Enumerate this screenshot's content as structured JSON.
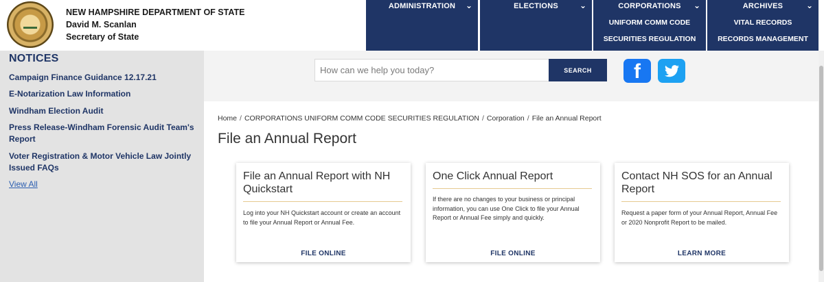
{
  "header": {
    "agency": "NEW HAMPSHIRE DEPARTMENT OF STATE",
    "official": "David M. Scanlan",
    "title": "Secretary of State"
  },
  "nav": [
    {
      "label": "ADMINISTRATION",
      "sub": []
    },
    {
      "label": "ELECTIONS",
      "sub": []
    },
    {
      "label": "CORPORATIONS",
      "sub": [
        "UNIFORM COMM CODE",
        "SECURITIES REGULATION"
      ]
    },
    {
      "label": "ARCHIVES",
      "sub": [
        "VITAL RECORDS",
        "RECORDS MANAGEMENT"
      ]
    }
  ],
  "sidebar": {
    "title": "NOTICES",
    "items": [
      "Campaign Finance Guidance 12.17.21",
      "E-Notarization Law Information",
      "Windham Election Audit",
      "Press Release-Windham Forensic Audit Team's Report",
      "Voter Registration & Motor Vehicle Law Jointly Issued FAQs"
    ],
    "view_all": "View All"
  },
  "search": {
    "placeholder": "How can we help you today?",
    "button": "SEARCH"
  },
  "social": {
    "facebook_glyph": "f",
    "icons": [
      "facebook-icon",
      "twitter-icon"
    ],
    "colors": {
      "facebook": "#1877f2",
      "twitter": "#1da1f2"
    }
  },
  "breadcrumb": [
    "Home",
    "CORPORATIONS UNIFORM COMM CODE SECURITIES REGULATION",
    "Corporation",
    "File an Annual Report"
  ],
  "page_title": "File an Annual Report",
  "cards": [
    {
      "title": "File an Annual Report with NH Quickstart",
      "text": "Log into your NH Quickstart account or create an account to file your Annual Report or Annual Fee.",
      "link": "FILE ONLINE"
    },
    {
      "title": "One Click Annual Report",
      "text": "If there are no changes to your business or principal information, you can use One Click to file your Annual Report or Annual Fee simply and quickly.",
      "link": "FILE ONLINE"
    },
    {
      "title": "Contact NH SOS for an Annual Report",
      "text": "Request a paper form of your Annual Report, Annual Fee or 2020 Nonprofit Report to be mailed.",
      "link": "LEARN MORE"
    }
  ],
  "theme": {
    "navy": "#1f3566",
    "sidebar_bg": "#e3e3e3",
    "accent_rule": "#e5c98f"
  }
}
